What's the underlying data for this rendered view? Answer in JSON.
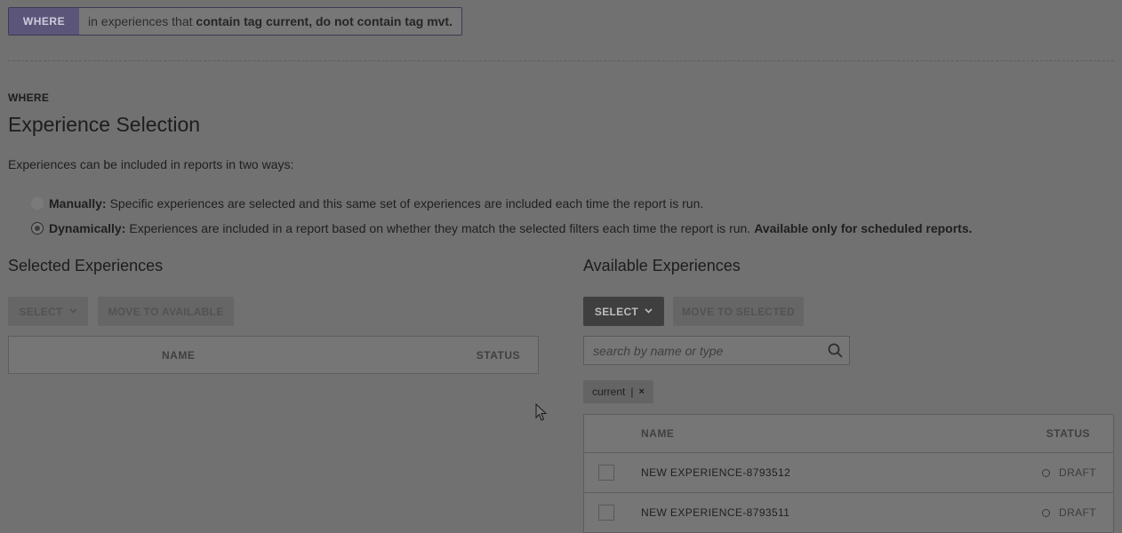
{
  "summary": {
    "tag": "WHERE",
    "prefix": "in experiences that",
    "bold": "contain tag current, do not contain tag mvt."
  },
  "section": {
    "eyebrow": "WHERE",
    "title": "Experience Selection",
    "intro": "Experiences can be included in reports in two ways:"
  },
  "options": [
    {
      "label": "Manually:",
      "text": "Specific experiences are selected and this same set of experiences are included each time the report is run.",
      "tail": "",
      "selected": false
    },
    {
      "label": "Dynamically:",
      "text": "Experiences are included in a report based on whether they match the selected filters each time the report is run.",
      "tail": "Available only for scheduled reports.",
      "selected": true
    }
  ],
  "selected_panel": {
    "title": "Selected Experiences",
    "select_label": "SELECT",
    "move_label": "MOVE TO AVAILABLE",
    "columns": {
      "name": "NAME",
      "status": "STATUS"
    }
  },
  "available_panel": {
    "title": "Available Experiences",
    "select_label": "SELECT",
    "move_label": "MOVE TO SELECTED",
    "search_placeholder": "search by name or type",
    "filter_chip": "current",
    "chip_sep": "|",
    "chip_remove": "×",
    "columns": {
      "name": "NAME",
      "status": "STATUS"
    },
    "rows": [
      {
        "name": "NEW EXPERIENCE-8793512",
        "status": "DRAFT"
      },
      {
        "name": "NEW EXPERIENCE-8793511",
        "status": "DRAFT"
      }
    ]
  },
  "icons": {
    "chevron": "chevron-down-icon",
    "search": "search-icon",
    "close": "close-icon",
    "status": "status-dot-icon",
    "cursor": "mouse-cursor-icon"
  }
}
